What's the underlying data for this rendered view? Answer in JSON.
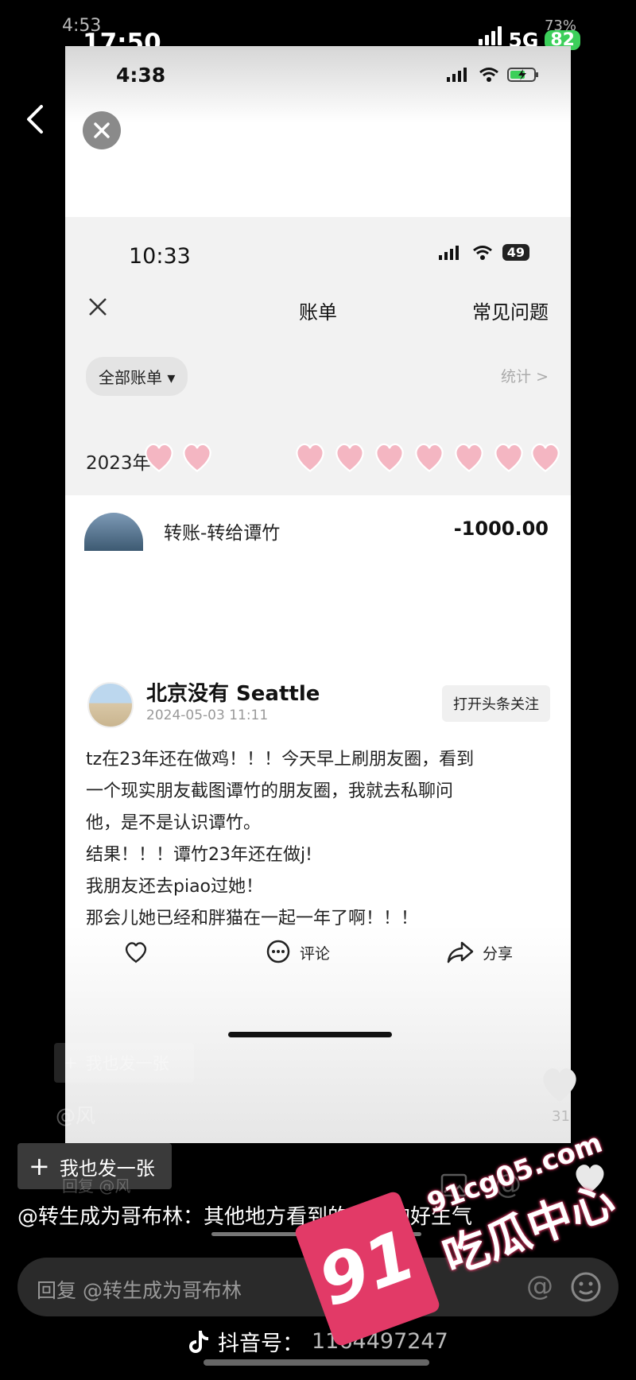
{
  "outer_status": {
    "time_ghost": "4:53",
    "time": "17:50",
    "network": "5G",
    "battery": "82",
    "battery_ghost": "73%"
  },
  "screenshot": {
    "status": {
      "time": "4:38"
    },
    "inner_status": {
      "time": "10:33",
      "battery": "49"
    },
    "bill": {
      "title": "账单",
      "faq": "常见问题",
      "filter": "全部账单 ▾",
      "stats": "统计 >",
      "month": "2023年",
      "item_desc": "转账-转给谭竹",
      "item_amount": "-1000.00"
    },
    "post": {
      "author": "北京没有 Seattle",
      "date": "2024-05-03 11:11",
      "follow": "打开头条关注",
      "lines": [
        "tz在23年还在做鸡！！！今天早上刷朋友圈，看到",
        "一个现实朋友截图谭竹的朋友圈，我就去私聊问",
        "他，是不是认识谭竹。",
        "结果！！！谭竹23年还在做j!",
        "我朋友还去piao过她！",
        "那会儿她已经和胖猫在一起一年了啊！！！"
      ],
      "actions": {
        "comment": "评论",
        "share": "分享"
      }
    }
  },
  "overlay": {
    "ghost_post_btn": "我也发一张",
    "ghost_at": "@风",
    "like_count": "31",
    "post_btn": "我也发一张",
    "comment": "@转生成为哥布林：其他地方看到的，真的好生气",
    "ghost_reply": "回复 @风",
    "reply_placeholder": "回复 @转生成为哥布林",
    "douyin_label": "抖音号：",
    "douyin_id": "1164497247"
  },
  "watermark": {
    "badge": "91",
    "url": "91cg05.com",
    "cn": "吃瓜中心"
  },
  "colors": {
    "watermark": "#e23a67",
    "battery_green": "#3ccf5a"
  }
}
